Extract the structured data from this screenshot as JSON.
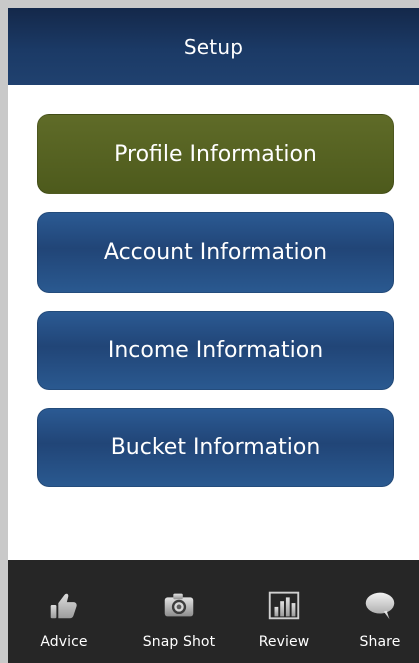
{
  "header": {
    "title": "Setup"
  },
  "menu": {
    "items": [
      {
        "label": "Profile Information"
      },
      {
        "label": "Account Information"
      },
      {
        "label": "Income Information"
      },
      {
        "label": "Bucket Information"
      }
    ]
  },
  "bottom_nav": {
    "items": [
      {
        "label": "Advice",
        "icon": "thumbs-up-icon"
      },
      {
        "label": "Snap Shot",
        "icon": "camera-icon"
      },
      {
        "label": "Review",
        "icon": "bar-chart-icon"
      },
      {
        "label": "Share",
        "icon": "speech-bubble-icon"
      }
    ]
  },
  "colors": {
    "header": "#1b3a66",
    "profile_button": "#556121",
    "info_button": "#264f84",
    "bottom_nav": "#262626",
    "text": "#ffffff"
  }
}
